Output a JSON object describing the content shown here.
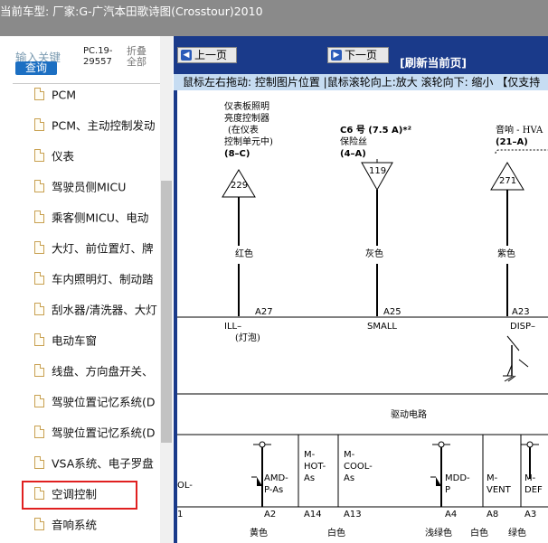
{
  "titlebar": {
    "text": "当前车型:  厂家:G-广汽本田歌诗图(Crosstour)2010"
  },
  "sidebar": {
    "search_hint": "输入关键",
    "search_button": "查询",
    "pc_label": "PC.19-29557",
    "fold_label": "折叠全部",
    "items": [
      {
        "label": "PCM"
      },
      {
        "label": "PCM、主动控制发动"
      },
      {
        "label": "仪表"
      },
      {
        "label": "驾驶员侧MICU"
      },
      {
        "label": "乘客侧MICU、电动"
      },
      {
        "label": "大灯、前位置灯、牌"
      },
      {
        "label": "车内照明灯、制动踏"
      },
      {
        "label": "刮水器/清洗器、大灯"
      },
      {
        "label": "电动车窗"
      },
      {
        "label": "线盘、方向盘开关、"
      },
      {
        "label": "驾驶位置记忆系统(D"
      },
      {
        "label": "驾驶位置记忆系统(D"
      },
      {
        "label": "VSA系统、电子罗盘"
      },
      {
        "label": "空调控制"
      },
      {
        "label": "音响系统"
      }
    ]
  },
  "nav": {
    "prev": "上一页",
    "next": "下一页",
    "refresh": "[刷新当前页]",
    "info": "鼠标左右拖动: 控制图片位置 |鼠标滚轮向上:放大  滚轮向下: 缩小 【仅支持"
  },
  "diagram": {
    "col1_title": [
      "仪表板照明",
      "亮度控制器",
      "(在仪表",
      "控制单元中)",
      "(8–C)"
    ],
    "col1_num": "229",
    "col1_color": "红色",
    "col1_pin": "A27",
    "col1_sig": "ILL–",
    "col1_sub": "(灯泡)",
    "col2_title": "C6 号 (7.5 A)*²",
    "col2_sub": "保险丝",
    "col2_ref": "(4–A)",
    "col2_num": "119",
    "col2_color": "灰色",
    "col2_pin": "A25",
    "col2_sig": "SMALL",
    "col3_title": "音响 - HVA",
    "col3_ref": "(21–A)",
    "col3_num": "271",
    "col3_color": "紫色",
    "col3_pin": "A23",
    "col3_sig": "DISP–",
    "drive_circuit": "驱动电路",
    "bottom_cols": [
      {
        "label": "OL-",
        "pin": "1",
        "color": ""
      },
      {
        "label": "AMD-P-As",
        "pin": "A2",
        "color": "黄色"
      },
      {
        "label": "M-HOT-As",
        "pin": "A14",
        "color": "白色"
      },
      {
        "label": "M-COOL-As",
        "pin": "A13",
        "color": ""
      },
      {
        "label": "MDD-P",
        "pin": "A4",
        "color": "浅绿色"
      },
      {
        "label": "M-VENT",
        "pin": "A8",
        "color": "白色"
      },
      {
        "label": "M-DEF",
        "pin": "A3",
        "color": "绿色"
      }
    ]
  }
}
